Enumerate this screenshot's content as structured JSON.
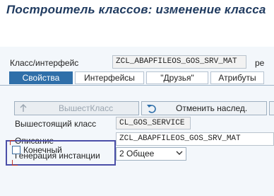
{
  "window": {
    "title": "Построитель классов: изменение класса"
  },
  "toolbar": {
    "icons": [
      "back-arrow-icon",
      "forward-arrow-icon",
      "other-object-icon",
      "display-change-icon",
      "activate-icon",
      "where-used-icon",
      "object-list-icon",
      "pencil-icon",
      "graph-icon",
      "hierarchy-icon",
      "list-icon",
      "layout-icon"
    ]
  },
  "header": {
    "class_label": "Класс/интерфейс",
    "class_value": "ZCL_ABAPFILEOS_GOS_SRV_MAT",
    "cut_label": "ре"
  },
  "tabs": [
    {
      "label": "Свойства",
      "active": true
    },
    {
      "label": "Интерфейсы",
      "active": false
    },
    {
      "label": "\"Друзья\"",
      "active": false
    },
    {
      "label": "Атрибуты",
      "active": false
    }
  ],
  "properties": {
    "superclass_button": "ВышестКласс",
    "undo_inherit_button": "Отменить наслед.",
    "superclass_label": "Вышестоящий класс",
    "superclass_value": "CL_GOS_SERVICE",
    "description_label": "Описание",
    "description_value": "ZCL_ABAPFILEOS_GOS_SRV_MAT",
    "instantiation_label": "Генерация инстанции",
    "instantiation_value": "2 Общее",
    "final_label": "Конечный",
    "final_checked": false
  },
  "colors": {
    "title": "#1f3a5f",
    "active_tab": "#2f6fa9",
    "highlight_box": "#4b4fa8"
  }
}
